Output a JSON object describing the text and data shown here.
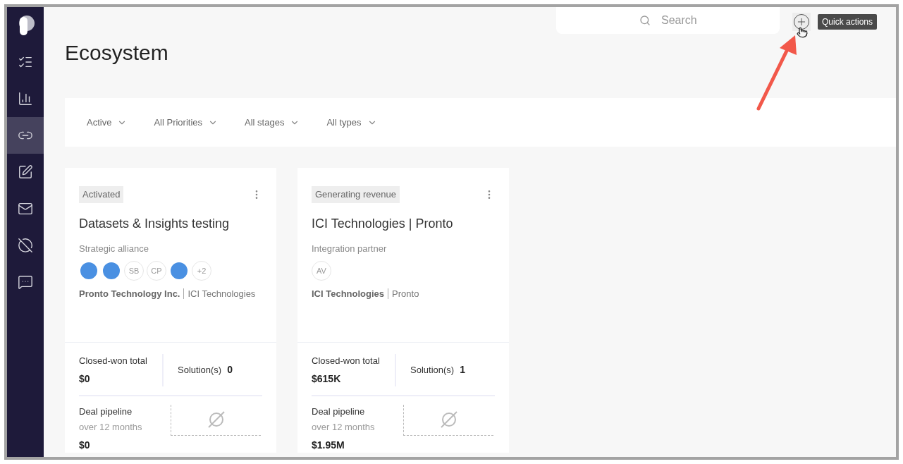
{
  "sidebar": {
    "items": [
      {
        "selected": false
      },
      {
        "selected": false
      },
      {
        "selected": true
      },
      {
        "selected": false
      },
      {
        "selected": false
      },
      {
        "selected": false
      },
      {
        "selected": false
      }
    ]
  },
  "page_title": "Ecosystem",
  "search": {
    "placeholder": "Search"
  },
  "quick_actions": {
    "tooltip": "Quick actions"
  },
  "filters": [
    {
      "label": "Active"
    },
    {
      "label": "All Priorities"
    },
    {
      "label": "All stages"
    },
    {
      "label": "All types"
    }
  ],
  "cards": [
    {
      "status": "Activated",
      "title": "Datasets & Insights testing",
      "type": "Strategic alliance",
      "avatars": [
        {
          "kind": "photo"
        },
        {
          "kind": "photo"
        },
        {
          "kind": "initials",
          "text": "SB"
        },
        {
          "kind": "initials",
          "text": "CP"
        },
        {
          "kind": "photo"
        },
        {
          "kind": "initials",
          "text": "+2"
        }
      ],
      "org_primary": "Pronto Technology Inc.",
      "org_secondary": "ICI Technologies",
      "closed_won_label": "Closed-won total",
      "closed_won_value": "$0",
      "solutions_label": "Solution(s)",
      "solutions_value": "0",
      "pipeline_label": "Deal pipeline",
      "pipeline_period": "over 12 months",
      "pipeline_value": "$0"
    },
    {
      "status": "Generating revenue",
      "title": "ICI Technologies | Pronto",
      "type": "Integration partner",
      "avatars": [
        {
          "kind": "initials",
          "text": "AV"
        }
      ],
      "org_primary": "ICI Technologies",
      "org_secondary": "Pronto",
      "closed_won_label": "Closed-won total",
      "closed_won_value": "$615K",
      "solutions_label": "Solution(s)",
      "solutions_value": "1",
      "pipeline_label": "Deal pipeline",
      "pipeline_period": "over 12 months",
      "pipeline_value": "$1.95M"
    }
  ]
}
